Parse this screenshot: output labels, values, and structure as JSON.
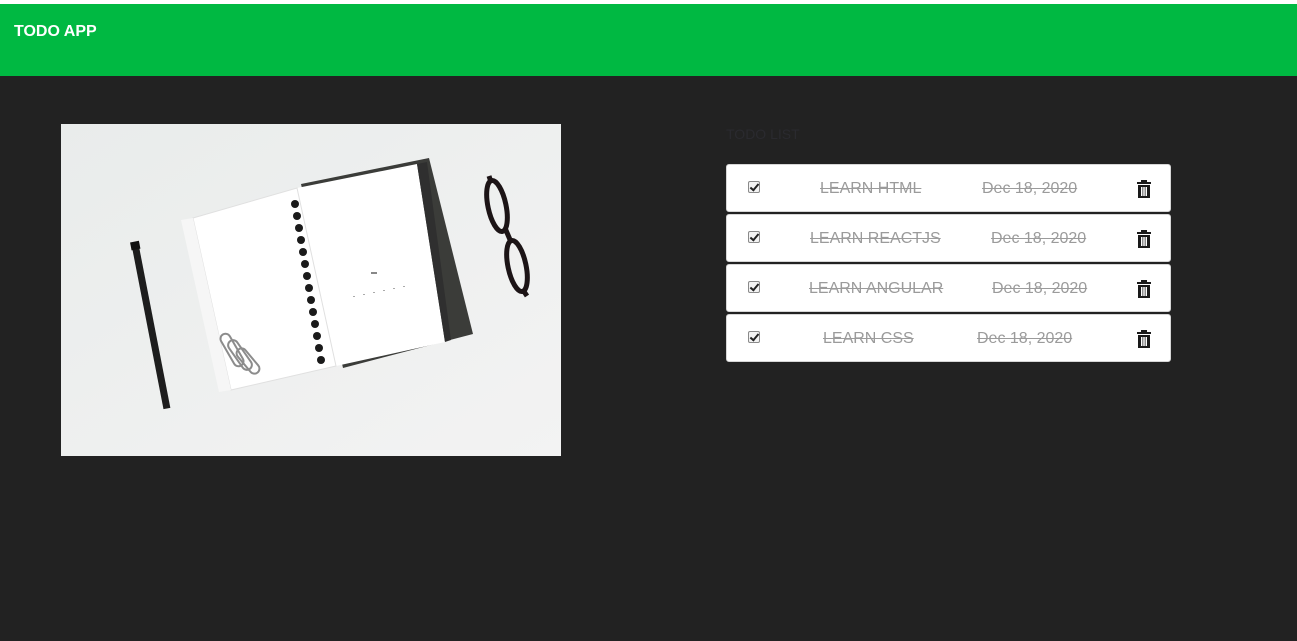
{
  "header": {
    "title": "TODO APP",
    "color": "#00b942"
  },
  "main": {
    "section_label": "TODO LIST",
    "image_alt": "notebook with pencil, paper clips and glasses"
  },
  "todos": [
    {
      "title": "LEARN HTML",
      "date": "Dec 18, 2020",
      "completed": true
    },
    {
      "title": "LEARN REACTJS",
      "date": "Dec 18, 2020",
      "completed": true
    },
    {
      "title": "LEARN ANGULAR",
      "date": "Dec 18, 2020",
      "completed": true
    },
    {
      "title": "LEARN CSS",
      "date": "Dec 18, 2020",
      "completed": true
    }
  ],
  "icons": {
    "delete": "trash-icon",
    "check": "checkbox-icon"
  }
}
